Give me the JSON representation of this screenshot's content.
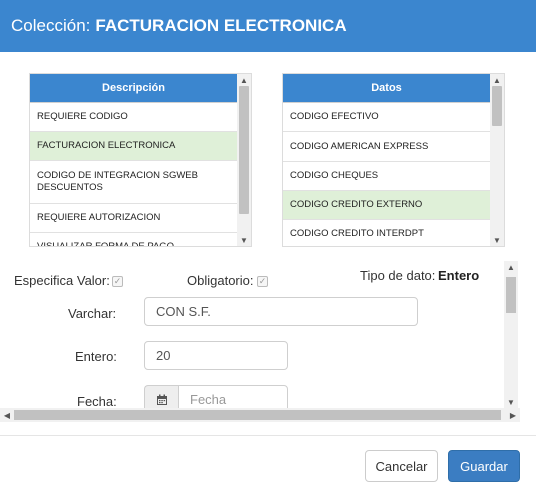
{
  "header": {
    "title_prefix": "Colección:",
    "title_name": "FACTURACION ELECTRONICA"
  },
  "left_list": {
    "header": "Descripción",
    "rows": [
      "REQUIERE CODIGO",
      "FACTURACION ELECTRONICA",
      "CODIGO DE INTEGRACION SGWEB DESCUENTOS",
      "REQUIERE AUTORIZACION",
      "VISUALIZAR FORMA DE PAGO"
    ],
    "selected_index": 1
  },
  "right_list": {
    "header": "Datos",
    "rows": [
      "CODIGO EFECTIVO",
      "CODIGO AMERICAN EXPRESS",
      "CODIGO CHEQUES",
      "CODIGO CREDITO EXTERNO",
      "CODIGO CREDITO INTERDPT"
    ],
    "selected_index": 3
  },
  "form": {
    "especifica_valor_label": "Especifica Valor:",
    "especifica_valor_checked": true,
    "obligatorio_label": "Obligatorio:",
    "obligatorio_checked": true,
    "tipo_dato_label": "Tipo de dato:",
    "tipo_dato_value": "Entero",
    "varchar_label": "Varchar:",
    "varchar_value": "CON S.F.",
    "entero_label": "Entero:",
    "entero_value": "20",
    "fecha_label": "Fecha:",
    "fecha_placeholder": "Fecha"
  },
  "icons": {
    "calendar": "calendar-icon",
    "check": "checkmark-icon",
    "scroll_up": "scroll-up-arrow-icon",
    "scroll_down": "scroll-down-arrow-icon",
    "scroll_left": "scroll-left-arrow-icon",
    "scroll_right": "scroll-right-arrow-icon"
  },
  "footer": {
    "cancel_label": "Cancelar",
    "save_label": "Guardar"
  },
  "colors": {
    "primary": "#3b86cf",
    "selected_row": "#dff0d8"
  }
}
